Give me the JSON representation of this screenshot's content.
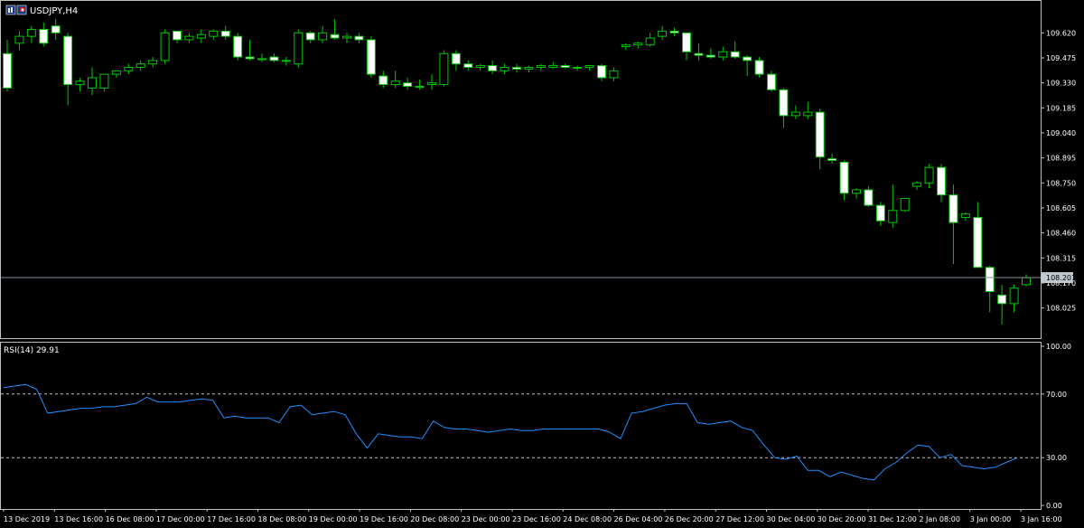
{
  "window": {
    "title": "USDJPY,H4"
  },
  "icons": [
    "chart-window-icon",
    "symbol-flag-icon"
  ],
  "current_price": {
    "value": 108.201,
    "label": "108.201"
  },
  "colors": {
    "background": "#000000",
    "panel_border": "#c0c0c0",
    "bull_body": "#000000",
    "bear_body": "#ffffff",
    "wick": "#00c800",
    "rsi_line": "#1e90ff",
    "level_line": "#c0c0c0",
    "price_line": "#8090a0"
  },
  "chart_data": [
    {
      "type": "candlestick",
      "symbol": "USDJPY",
      "timeframe": "H4",
      "title": "USDJPY,H4",
      "ylim": [
        107.85,
        109.8
      ],
      "y_ticks": [
        "109.620",
        "109.475",
        "109.330",
        "109.185",
        "109.040",
        "108.895",
        "108.750",
        "108.605",
        "108.460",
        "108.315",
        "108.170",
        "108.025"
      ],
      "x_ticks": [
        "13 Dec 2019",
        "13 Dec 16:00",
        "16 Dec 08:00",
        "17 Dec 00:00",
        "17 Dec 16:00",
        "18 Dec 08:00",
        "19 Dec 00:00",
        "19 Dec 16:00",
        "20 Dec 08:00",
        "23 Dec 00:00",
        "23 Dec 16:00",
        "24 Dec 08:00",
        "26 Dec 04:00",
        "26 Dec 20:00",
        "27 Dec 12:00",
        "30 Dec 04:00",
        "30 Dec 20:00",
        "31 Dec 12:00",
        "2 Jan 08:00",
        "3 Jan 00:00",
        "3 Jan 16:00"
      ],
      "candles": [
        [
          109.5,
          109.58,
          109.28,
          109.3
        ],
        [
          109.56,
          109.63,
          109.52,
          109.6
        ],
        [
          109.6,
          109.66,
          109.56,
          109.64
        ],
        [
          109.64,
          109.68,
          109.54,
          109.56
        ],
        [
          109.66,
          109.7,
          109.58,
          109.62
        ],
        [
          109.6,
          109.62,
          109.2,
          109.32
        ],
        [
          109.32,
          109.36,
          109.28,
          109.34
        ],
        [
          109.3,
          109.42,
          109.26,
          109.36
        ],
        [
          109.3,
          109.38,
          109.28,
          109.38
        ],
        [
          109.38,
          109.4,
          109.36,
          109.4
        ],
        [
          109.4,
          109.44,
          109.38,
          109.42
        ],
        [
          109.42,
          109.46,
          109.4,
          109.44
        ],
        [
          109.44,
          109.48,
          109.42,
          109.46
        ],
        [
          109.46,
          109.64,
          109.44,
          109.62
        ],
        [
          109.63,
          109.63,
          109.56,
          109.58
        ],
        [
          109.58,
          109.62,
          109.56,
          109.6
        ],
        [
          109.59,
          109.64,
          109.56,
          109.61
        ],
        [
          109.6,
          109.64,
          109.58,
          109.63
        ],
        [
          109.63,
          109.66,
          109.58,
          109.6
        ],
        [
          109.6,
          109.62,
          109.46,
          109.48
        ],
        [
          109.48,
          109.58,
          109.46,
          109.47
        ],
        [
          109.47,
          109.5,
          109.45,
          109.47
        ],
        [
          109.48,
          109.5,
          109.45,
          109.46
        ],
        [
          109.46,
          109.48,
          109.43,
          109.46
        ],
        [
          109.44,
          109.64,
          109.42,
          109.62
        ],
        [
          109.62,
          109.63,
          109.56,
          109.58
        ],
        [
          109.58,
          109.66,
          109.56,
          109.62
        ],
        [
          109.61,
          109.7,
          109.58,
          109.59
        ],
        [
          109.59,
          109.62,
          109.56,
          109.6
        ],
        [
          109.6,
          109.62,
          109.56,
          109.58
        ],
        [
          109.58,
          109.6,
          109.36,
          109.38
        ],
        [
          109.37,
          109.4,
          109.3,
          109.32
        ],
        [
          109.32,
          109.4,
          109.3,
          109.34
        ],
        [
          109.33,
          109.36,
          109.29,
          109.31
        ],
        [
          109.31,
          109.35,
          109.29,
          109.31
        ],
        [
          109.32,
          109.38,
          109.29,
          109.33
        ],
        [
          109.32,
          109.52,
          109.31,
          109.5
        ],
        [
          109.5,
          109.52,
          109.4,
          109.44
        ],
        [
          109.44,
          109.46,
          109.4,
          109.42
        ],
        [
          109.42,
          109.44,
          109.4,
          109.43
        ],
        [
          109.43,
          109.46,
          109.38,
          109.4
        ],
        [
          109.4,
          109.44,
          109.38,
          109.42
        ],
        [
          109.42,
          109.44,
          109.39,
          109.41
        ],
        [
          109.41,
          109.43,
          109.39,
          109.42
        ],
        [
          109.42,
          109.44,
          109.4,
          109.43
        ],
        [
          109.42,
          109.45,
          109.41,
          109.43
        ],
        [
          109.43,
          109.44,
          109.41,
          109.42
        ],
        [
          109.42,
          109.43,
          109.4,
          109.42
        ],
        [
          109.42,
          109.43,
          109.4,
          109.43
        ],
        [
          109.43,
          109.44,
          109.34,
          109.36
        ],
        [
          109.36,
          109.42,
          109.34,
          109.4
        ],
        [
          109.54,
          109.56,
          109.52,
          109.55
        ],
        [
          109.55,
          109.57,
          109.53,
          109.56
        ],
        [
          109.55,
          109.62,
          109.54,
          109.59
        ],
        [
          109.6,
          109.66,
          109.58,
          109.63
        ],
        [
          109.63,
          109.65,
          109.6,
          109.62
        ],
        [
          109.62,
          109.62,
          109.46,
          109.51
        ],
        [
          109.5,
          109.56,
          109.46,
          109.49
        ],
        [
          109.49,
          109.53,
          109.47,
          109.48
        ],
        [
          109.48,
          109.54,
          109.46,
          109.51
        ],
        [
          109.51,
          109.57,
          109.47,
          109.48
        ],
        [
          109.48,
          109.49,
          109.37,
          109.46
        ],
        [
          109.46,
          109.48,
          109.36,
          109.38
        ],
        [
          109.38,
          109.4,
          109.28,
          109.29
        ],
        [
          109.29,
          109.3,
          109.07,
          109.14
        ],
        [
          109.14,
          109.2,
          109.12,
          109.16
        ],
        [
          109.14,
          109.22,
          109.12,
          109.16
        ],
        [
          109.16,
          109.18,
          108.83,
          108.9
        ],
        [
          108.89,
          108.92,
          108.86,
          108.88
        ],
        [
          108.87,
          108.88,
          108.65,
          108.69
        ],
        [
          108.69,
          108.72,
          108.66,
          108.71
        ],
        [
          108.71,
          108.73,
          108.61,
          108.62
        ],
        [
          108.62,
          108.64,
          108.5,
          108.53
        ],
        [
          108.52,
          108.74,
          108.49,
          108.59
        ],
        [
          108.59,
          108.66,
          108.58,
          108.66
        ],
        [
          108.73,
          108.76,
          108.71,
          108.75
        ],
        [
          108.75,
          108.86,
          108.72,
          108.84
        ],
        [
          108.84,
          108.86,
          108.64,
          108.68
        ],
        [
          108.68,
          108.74,
          108.28,
          108.52
        ],
        [
          108.55,
          108.58,
          108.53,
          108.57
        ],
        [
          108.55,
          108.64,
          108.27,
          108.26
        ],
        [
          108.26,
          108.27,
          108.0,
          108.12
        ],
        [
          108.1,
          108.16,
          107.93,
          108.05
        ],
        [
          108.05,
          108.16,
          108.0,
          108.14
        ],
        [
          108.16,
          108.22,
          108.15,
          108.2
        ]
      ]
    },
    {
      "type": "line",
      "title": "RSI(14) 29.91",
      "indicator": "RSI",
      "period": 14,
      "last_value": 29.91,
      "ylim": [
        0,
        100
      ],
      "y_ticks": [
        "100.00",
        "70.00",
        "30.00",
        "0.00"
      ],
      "levels": [
        70,
        30
      ],
      "values": [
        74,
        75,
        76,
        73,
        58,
        59,
        60,
        61,
        61,
        62,
        62,
        63,
        64,
        68,
        65,
        65,
        65,
        66,
        67,
        66,
        55,
        56,
        55,
        55,
        55,
        52,
        62,
        63,
        57,
        58,
        59,
        57,
        45,
        36,
        45,
        44,
        43,
        43,
        42,
        53,
        49,
        48,
        48,
        47,
        46,
        47,
        48,
        47,
        47,
        48,
        48,
        48,
        48,
        48,
        48,
        46,
        42,
        58,
        59,
        61,
        63,
        64,
        64,
        52,
        51,
        52,
        53,
        49,
        47,
        38,
        30,
        29,
        31,
        22,
        22,
        18,
        21,
        19,
        17,
        16,
        23,
        27,
        33,
        38,
        37,
        30,
        32,
        25,
        24,
        23,
        24,
        27,
        29.91
      ]
    }
  ]
}
